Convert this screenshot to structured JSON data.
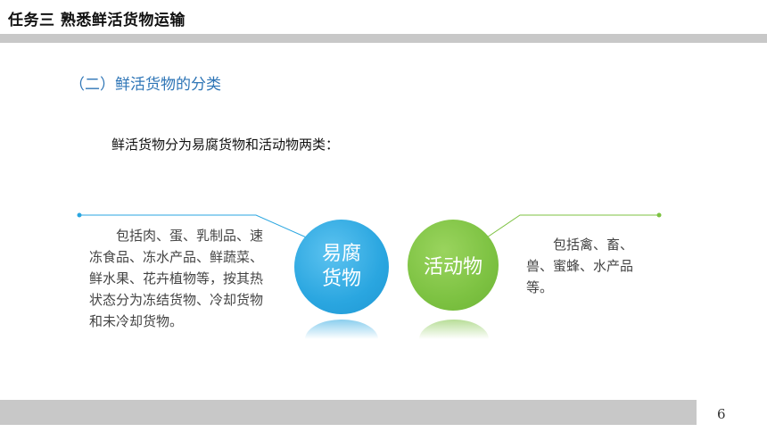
{
  "header": {
    "title": "任务三  熟悉鲜活货物运输"
  },
  "section": {
    "title": "（二）鲜活货物的分类"
  },
  "intro": {
    "text": "鲜活货物分为易腐货物和活动物两类："
  },
  "categories": [
    {
      "label_line1": "易腐",
      "label_line2": "货物",
      "color": "#2aa6e0",
      "description": "包括肉、蛋、乳制品、速冻食品、冻水产品、鲜蔬菜、鲜水果、花卉植物等，按其热状态分为冻结货物、冷却货物和未冷却货物。"
    },
    {
      "label": "活动物",
      "color": "#7dc242",
      "description": "包括禽、畜、兽、蜜蜂、水产品等。"
    }
  ],
  "footer": {
    "page_number": "6"
  }
}
